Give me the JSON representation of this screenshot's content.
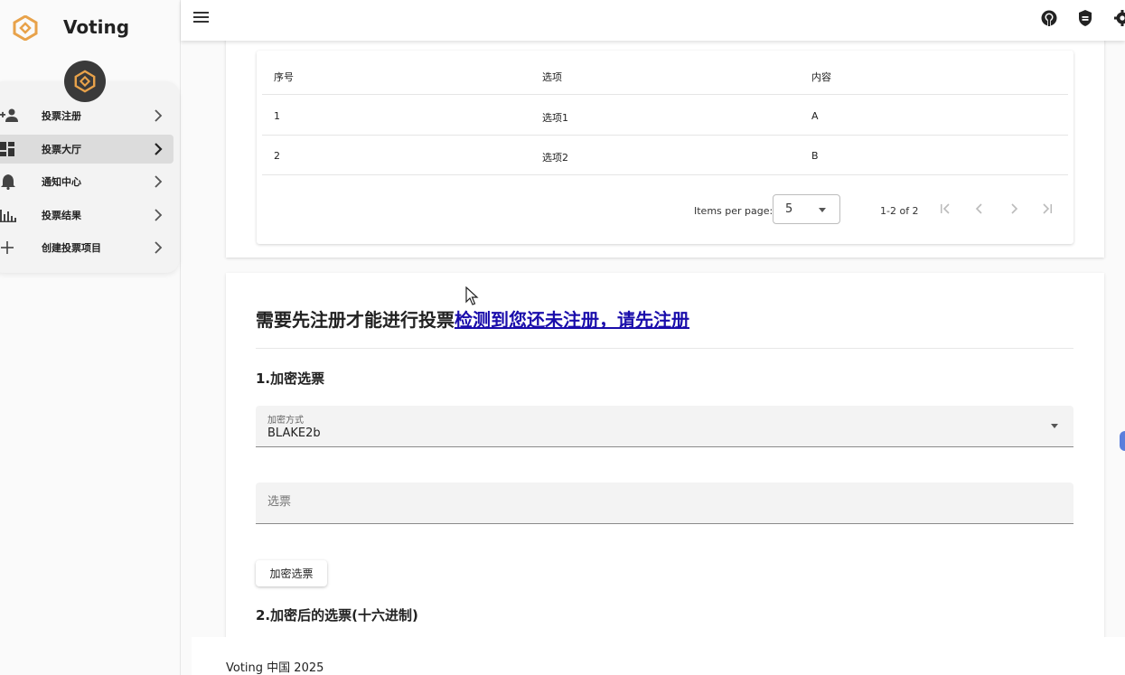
{
  "app": {
    "title": "Voting",
    "logo_icon": "hexagon-logo-icon",
    "accent": "#e8a24a"
  },
  "sidebar": {
    "items": [
      {
        "label": "投票注册",
        "icon": "person-add-icon"
      },
      {
        "label": "投票大厅",
        "icon": "dashboard-icon",
        "active": true
      },
      {
        "label": "通知中心",
        "icon": "bell-icon"
      },
      {
        "label": "投票结果",
        "icon": "bar-chart-icon"
      },
      {
        "label": "创建投票项目",
        "icon": "plus-icon"
      }
    ]
  },
  "topbar": {
    "icons": [
      "menu-icon",
      "github-icon",
      "shield-icon",
      "settings-icon"
    ]
  },
  "options_table": {
    "columns": [
      "序号",
      "选项",
      "内容"
    ],
    "rows": [
      [
        "1",
        "选项1",
        "A"
      ],
      [
        "2",
        "选项2",
        "B"
      ]
    ],
    "items_per_page_label": "Items per page:",
    "items_per_page": "5",
    "range_label": "1-2 of 2"
  },
  "register": {
    "title": "需要先注册才能进行投票",
    "link": "检测到您还未注册，请先注册"
  },
  "encrypt": {
    "section1_title": "1.加密选票",
    "method_label": "加密方式",
    "method_value": "BLAKE2b",
    "ballot_placeholder": "选票",
    "button_label": "加密选票",
    "section2_title": "2.加密后的选票(十六进制)"
  },
  "footer": {
    "text": "Voting 中国 2025"
  }
}
